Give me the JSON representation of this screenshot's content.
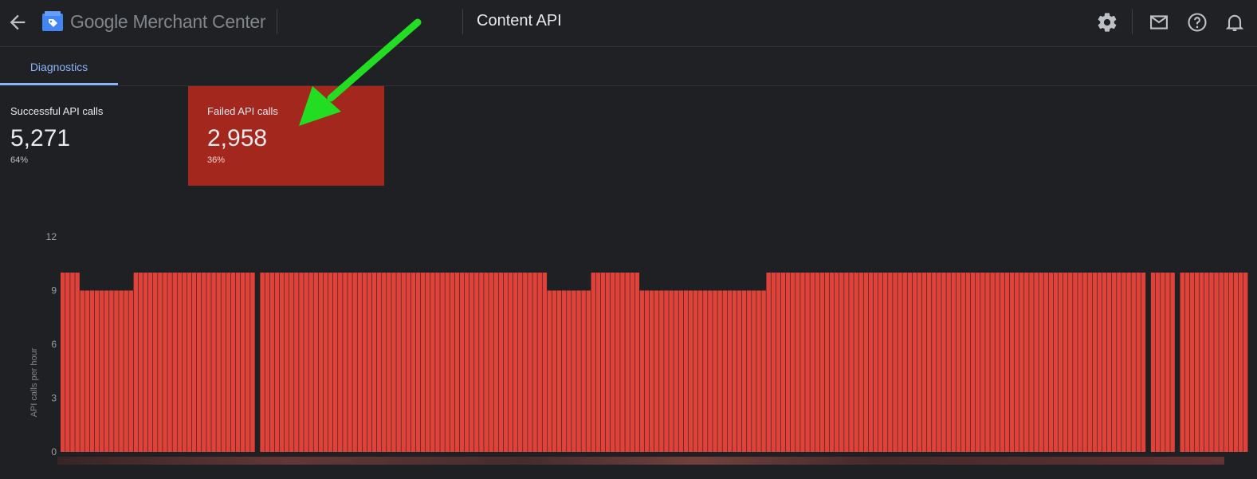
{
  "topbar": {
    "brand": "Google Merchant Center",
    "page_title": "Content API",
    "icons": [
      "back-arrow-icon",
      "merchant-logo-icon",
      "gear-icon",
      "mail-icon",
      "help-icon",
      "bell-icon"
    ]
  },
  "tabs": [
    {
      "label": "Diagnostics",
      "selected": true
    }
  ],
  "stats": {
    "successful": {
      "label": "Successful API calls",
      "value": "5,271",
      "percent": "64%"
    },
    "failed": {
      "label": "Failed API calls",
      "value": "2,958",
      "percent": "36%",
      "color": "#a4271d"
    }
  },
  "colors": {
    "accent": "#8ab4f8",
    "bar": "#e0423a",
    "annotation_arrow": "#22dd22"
  },
  "chart_data": {
    "type": "bar",
    "ylabel": "API calls per hour",
    "yticks": [
      0,
      3,
      6,
      9,
      12
    ],
    "ylim": [
      0,
      12
    ],
    "x_tick_labels_obscured": true,
    "values": [
      10,
      10,
      10,
      10,
      9,
      9,
      9,
      9,
      9,
      9,
      9,
      9,
      9,
      9,
      9,
      10,
      10,
      10,
      10,
      10,
      10,
      10,
      10,
      10,
      10,
      10,
      10,
      10,
      10,
      10,
      10,
      10,
      10,
      10,
      10,
      10,
      10,
      10,
      10,
      10,
      0,
      10,
      10,
      10,
      10,
      10,
      10,
      10,
      10,
      10,
      10,
      10,
      10,
      10,
      10,
      10,
      10,
      10,
      10,
      10,
      10,
      10,
      10,
      10,
      10,
      10,
      10,
      10,
      10,
      10,
      10,
      10,
      10,
      10,
      10,
      10,
      10,
      10,
      10,
      10,
      10,
      10,
      10,
      10,
      10,
      10,
      10,
      10,
      10,
      10,
      10,
      10,
      10,
      10,
      10,
      10,
      10,
      10,
      10,
      10,
      9,
      9,
      9,
      9,
      9,
      9,
      9,
      9,
      9,
      10,
      10,
      10,
      10,
      10,
      10,
      10,
      10,
      10,
      10,
      9,
      9,
      9,
      9,
      9,
      9,
      9,
      9,
      9,
      9,
      9,
      9,
      9,
      9,
      9,
      9,
      9,
      9,
      9,
      9,
      9,
      9,
      9,
      9,
      9,
      9,
      10,
      10,
      10,
      10,
      10,
      10,
      10,
      10,
      10,
      10,
      10,
      10,
      10,
      10,
      10,
      10,
      10,
      10,
      10,
      10,
      10,
      10,
      10,
      10,
      10,
      10,
      10,
      10,
      10,
      10,
      10,
      10,
      10,
      10,
      10,
      10,
      10,
      10,
      10,
      10,
      10,
      10,
      10,
      10,
      10,
      10,
      10,
      10,
      10,
      10,
      10,
      10,
      10,
      10,
      10,
      10,
      10,
      10,
      10,
      10,
      10,
      10,
      10,
      10,
      10,
      10,
      10,
      10,
      10,
      10,
      10,
      10,
      10,
      10,
      10,
      10,
      10,
      10,
      0,
      10,
      10,
      10,
      10,
      10,
      0,
      10,
      10,
      10,
      10,
      10,
      10,
      10,
      10,
      10,
      10,
      10,
      10,
      10,
      10
    ]
  }
}
